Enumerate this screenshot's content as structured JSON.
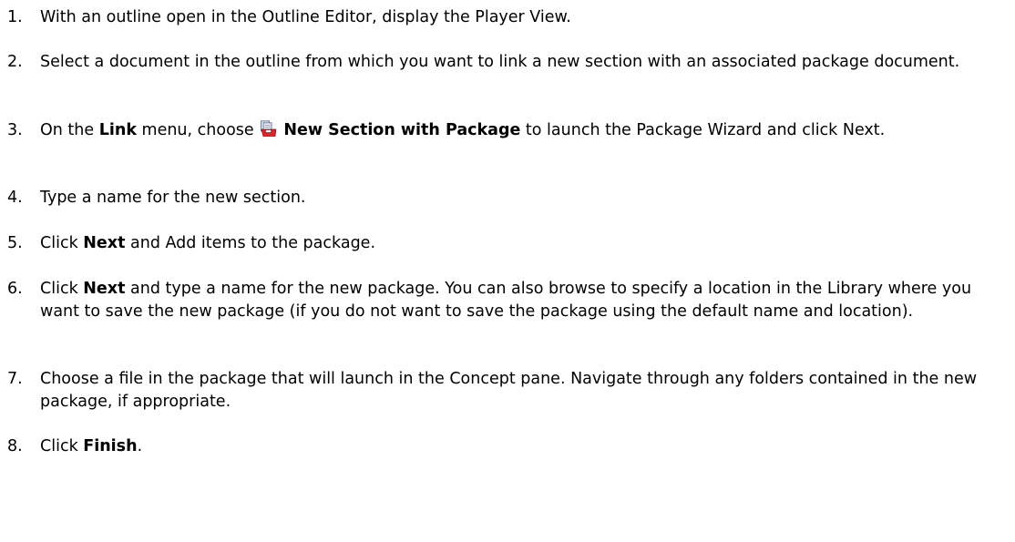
{
  "steps": [
    {
      "number": "1.",
      "parts": [
        {
          "t": "With an outline open in the Outline Editor, display the Player View."
        }
      ]
    },
    {
      "number": "2.",
      "parts": [
        {
          "t": "Select a document in the outline from which you want to link a new section with an associated package document."
        }
      ]
    },
    {
      "number": "3.",
      "parts": [
        {
          "t": "On the "
        },
        {
          "t": "Link",
          "b": true
        },
        {
          "t": " menu, choose "
        },
        {
          "icon": "new-section-with-package-icon"
        },
        {
          "t": " New Section with Package",
          "b": true
        },
        {
          "t": " to launch the Package Wizard and click Next."
        }
      ]
    },
    {
      "number": "4.",
      "parts": [
        {
          "t": "Type a name for the new section."
        }
      ]
    },
    {
      "number": "5.",
      "parts": [
        {
          "t": "Click "
        },
        {
          "t": "Next",
          "b": true
        },
        {
          "t": " and Add items to the package."
        }
      ]
    },
    {
      "number": "6.",
      "parts": [
        {
          "t": "Click "
        },
        {
          "t": "Next",
          "b": true
        },
        {
          "t": " and type a name for the new package. You can also browse to specify a location in the Library where you want to save the new package (if you do not want to save the package using the default name and location)."
        }
      ]
    },
    {
      "number": "7.",
      "parts": [
        {
          "t": "Choose a file in the package that will launch in the Concept pane. Navigate through any folders contained in the new package, if appropriate."
        }
      ]
    },
    {
      "number": "8.",
      "parts": [
        {
          "t": "Click "
        },
        {
          "t": "Finish",
          "b": true
        },
        {
          "t": "."
        }
      ]
    }
  ],
  "colors": {
    "text": "#000000",
    "background": "#ffffff",
    "icon_red": "#d8262b",
    "icon_page": "#e9eef6"
  }
}
